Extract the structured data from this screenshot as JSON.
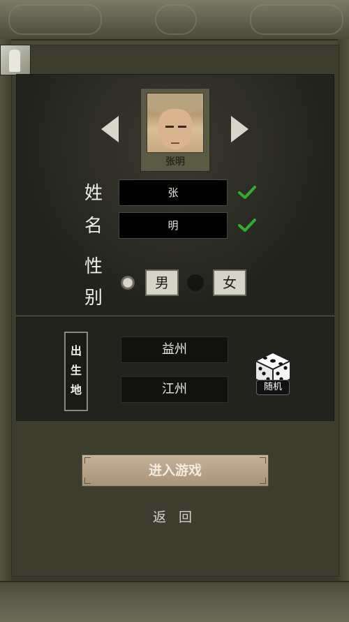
{
  "character": {
    "portrait_name": "张明"
  },
  "form": {
    "surname_label": "姓",
    "given_name_label": "名",
    "surname_value": "张",
    "given_name_value": "明",
    "gender_label_1": "性",
    "gender_label_2": "别",
    "gender_male": "男",
    "gender_female": "女",
    "gender_selected": "男"
  },
  "origin": {
    "tag_chars": [
      "出",
      "生",
      "地"
    ],
    "province": "益州",
    "region": "江州",
    "random_label": "随机"
  },
  "actions": {
    "enter_game": "进入游戏",
    "back": "返 回"
  },
  "colors": {
    "check": "#2fae2f",
    "enter_button": "#b8a488"
  },
  "icons": {
    "prev": "triangle-left",
    "next": "triangle-right",
    "valid": "check-icon",
    "random": "dice-icon"
  }
}
